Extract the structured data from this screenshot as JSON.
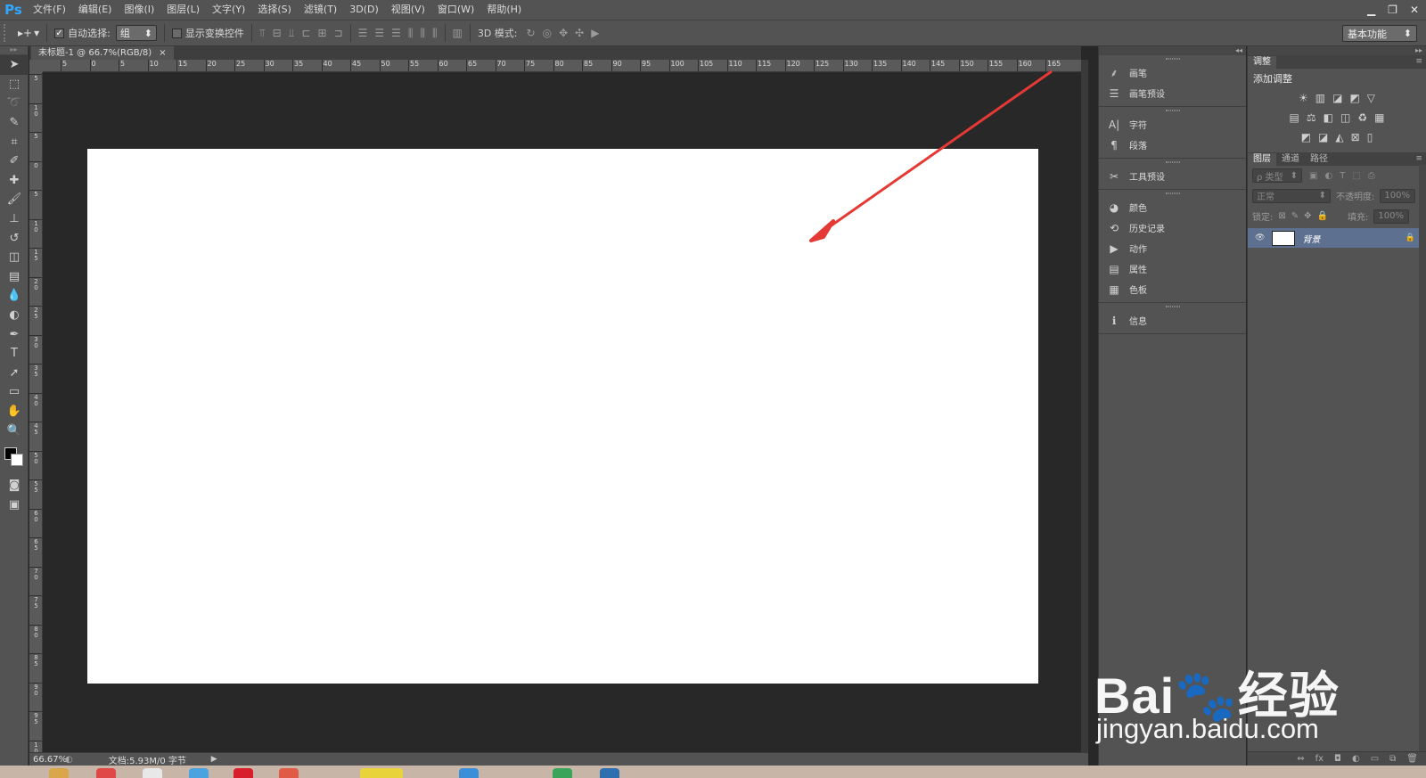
{
  "app": {
    "logo": "Ps"
  },
  "menu": [
    "文件(F)",
    "编辑(E)",
    "图像(I)",
    "图层(L)",
    "文字(Y)",
    "选择(S)",
    "滤镜(T)",
    "3D(D)",
    "视图(V)",
    "窗口(W)",
    "帮助(H)"
  ],
  "window_controls": {
    "minimize": "▁",
    "restore": "❐",
    "close": "✕"
  },
  "options": {
    "tool_glyph": "▸+",
    "auto_select_label": "自动选择:",
    "auto_select_checked": "✓",
    "auto_select_value": "组",
    "show_transform_label": "显示变换控件",
    "mode3d_label": "3D 模式:",
    "workspace": "基本功能"
  },
  "document": {
    "tab_title": "未标题-1 @ 66.7%(RGB/8)",
    "tab_close": "×",
    "ruler_top": [
      "5",
      "0",
      "5",
      "10",
      "15",
      "20",
      "25",
      "30",
      "35",
      "40",
      "45",
      "50",
      "55",
      "60",
      "65",
      "70",
      "75",
      "80",
      "85",
      "90",
      "95",
      "100",
      "105",
      "110",
      "115",
      "120",
      "125",
      "130",
      "135",
      "140",
      "145",
      "150",
      "155",
      "160",
      "165"
    ],
    "ruler_left": [
      "5",
      "1\n0",
      "5",
      "0",
      "5",
      "1\n0",
      "1\n5",
      "2\n0",
      "2\n5",
      "3\n0",
      "3\n5",
      "4\n0",
      "4\n5",
      "5\n0",
      "5\n5",
      "6\n0",
      "6\n5",
      "7\n0",
      "7\n5",
      "8\n0",
      "8\n5",
      "9\n0",
      "9\n5",
      "1\n0"
    ]
  },
  "status": {
    "zoom": "66.67%",
    "doc_info": "文档:5.93M/0 字节",
    "arrow": "▶"
  },
  "dock": {
    "groups": [
      [
        {
          "icon": "brush-icon",
          "glyph": "⸙",
          "label": "画笔"
        },
        {
          "icon": "brush-presets-icon",
          "glyph": "☰",
          "label": "画笔预设"
        }
      ],
      [
        {
          "icon": "character-icon",
          "glyph": "A|",
          "label": "字符"
        },
        {
          "icon": "paragraph-icon",
          "glyph": "¶",
          "label": "段落"
        }
      ],
      [
        {
          "icon": "tool-presets-icon",
          "glyph": "✂",
          "label": "工具预设"
        }
      ],
      [
        {
          "icon": "color-icon",
          "glyph": "◕",
          "label": "颜色"
        },
        {
          "icon": "history-icon",
          "glyph": "⟲",
          "label": "历史记录"
        },
        {
          "icon": "actions-icon",
          "glyph": "▶",
          "label": "动作"
        },
        {
          "icon": "properties-icon",
          "glyph": "▤",
          "label": "属性"
        },
        {
          "icon": "swatches-icon",
          "glyph": "▦",
          "label": "色板"
        }
      ],
      [
        {
          "icon": "info-icon",
          "glyph": "ℹ",
          "label": "信息"
        }
      ]
    ]
  },
  "adjustments": {
    "tab": "调整",
    "title": "添加调整",
    "rows": [
      [
        "☀",
        "▥",
        "◪",
        "◩",
        "▽"
      ],
      [
        "▤",
        "⚖",
        "◧",
        "◫",
        "♻",
        "▦"
      ],
      [
        "◩",
        "◪",
        "◭",
        "⊠",
        "▯"
      ]
    ]
  },
  "layers": {
    "tabs": [
      "图层",
      "通道",
      "路径"
    ],
    "filter_kind": "ρ 类型",
    "blend_mode": "正常",
    "opacity_label": "不透明度:",
    "opacity_value": "100%",
    "lock_label": "锁定:",
    "fill_label": "填充:",
    "fill_value": "100%",
    "items": [
      {
        "name": "背景",
        "visible_glyph": "👁",
        "lock_glyph": "🔒"
      }
    ],
    "footer": [
      "⇔",
      "fx",
      "◘",
      "◐",
      "▭",
      "⧉",
      "🗑"
    ]
  },
  "watermark": {
    "logo": "Bai🐾经验",
    "url": "jingyan.baidu.com"
  },
  "colors": {
    "accent_logo": "#31a8ff",
    "annotation_arrow": "#e53935",
    "layer_selected": "#5e7090"
  }
}
